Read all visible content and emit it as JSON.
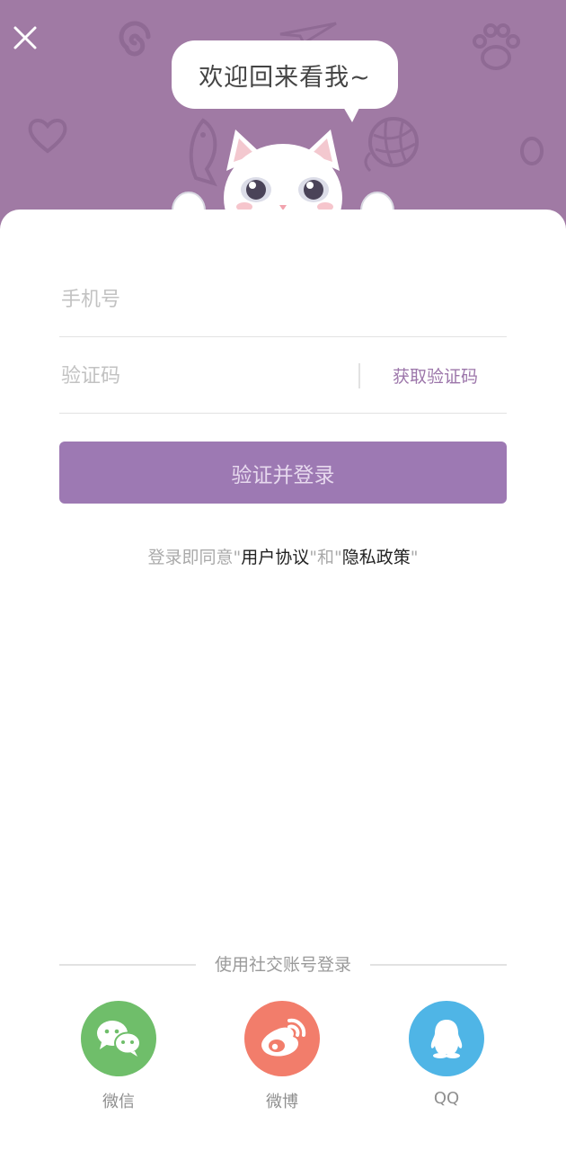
{
  "header": {
    "bubble_text": "欢迎回来看我~"
  },
  "form": {
    "phone_placeholder": "手机号",
    "code_placeholder": "验证码",
    "get_code_label": "获取验证码",
    "submit_label": "验证并登录"
  },
  "agreement": {
    "prefix": "登录即同意",
    "q1": "\"",
    "user_agreement": "用户协议",
    "q2": "\"",
    "middle": "和",
    "q3": "\"",
    "privacy_policy": "隐私政策",
    "q4": "\""
  },
  "social": {
    "title": "使用社交账号登录",
    "items": [
      {
        "label": "微信",
        "icon": "wechat-icon",
        "color": "#6fbe6a"
      },
      {
        "label": "微博",
        "icon": "weibo-icon",
        "color": "#f27d6b"
      },
      {
        "label": "QQ",
        "icon": "qq-icon",
        "color": "#4fb5e6"
      }
    ]
  },
  "colors": {
    "header_bg": "#a07aa4",
    "accent": "#9d79b3"
  }
}
